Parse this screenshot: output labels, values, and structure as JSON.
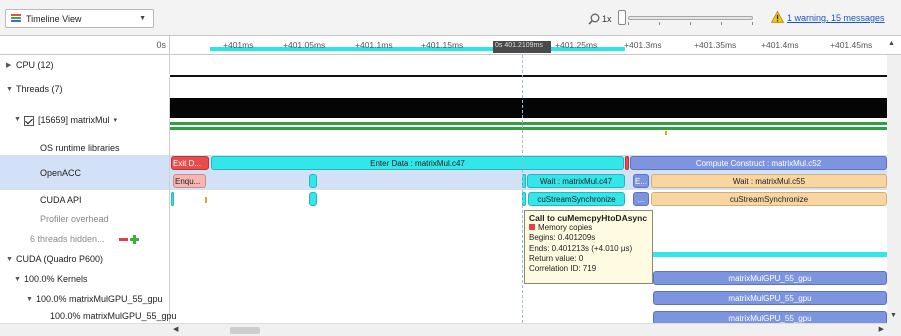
{
  "toolbar": {
    "view_label": "Timeline View",
    "zoom_level": "1x",
    "warning_link": "1 warning, 15 messages"
  },
  "ruler": {
    "zero_label": "0s",
    "ticks": [
      "+401ms",
      "+401.05ms",
      "+401.1ms",
      "+401.15ms",
      "+401.25ms",
      "+401.3ms",
      "+401.35ms",
      "+401.4ms",
      "+401.45ms"
    ],
    "cursor_label": "0s 401.2109ms"
  },
  "rows": {
    "cpu": "CPU (12)",
    "threads": "Threads (7)",
    "thread": "[15659] matrixMul",
    "os_runtime": "OS runtime libraries",
    "openacc": "OpenACC",
    "cuda_api": "CUDA API",
    "profiler": "Profiler overhead",
    "hidden": "6 threads hidden...",
    "cuda_device": "CUDA (Quadro P600)",
    "kernels": "100.0% Kernels",
    "kernel_group": "100.0% matrixMulGPU_55_gpu",
    "kernel_item": "100.0% matrixMulGPU_55_gpu"
  },
  "bars": {
    "exit_data": "Exit D...",
    "enter_data": "Enter Data : matrixMul.c47",
    "compute": "Compute Construct : matrixMul.c52",
    "enqueue": "Enqu...",
    "wait_47": "Wait : matrixMul.c47",
    "e_short": "E...",
    "wait_55": "Wait : matrixMul.c55",
    "cu_sync": "cuStreamSynchronize",
    "ellipsis": "...",
    "cu_sync_2": "cuStreamSynchronize",
    "kernel_1": "matrixMulGPU_55_gpu",
    "kernel_2": "matrixMulGPU_55_gpu",
    "kernel_3": "matrixMulGPU_55_gpu"
  },
  "tooltip": {
    "title": "Call to cuMemcpyHtoDAsync",
    "category": "Memory copies",
    "begins": "Begins: 0.401209s",
    "ends": "Ends: 0.401213s (+4.010 µs)",
    "return_value": "Return value: 0",
    "correlation": "Correlation ID: 719"
  },
  "colors": {
    "cyan": "#33e6ea",
    "red": "#e84d4d",
    "blue": "#7c95de",
    "tan": "#f7d6a4",
    "link": "#1a56c8",
    "green": "#2ea043"
  }
}
